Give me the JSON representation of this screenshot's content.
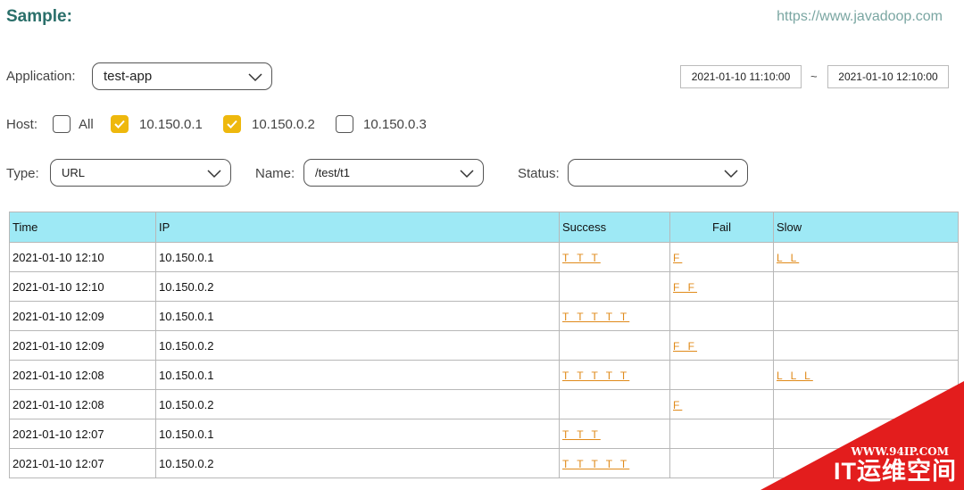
{
  "header": {
    "title": "Sample:",
    "site": "https://www.javadoop.com"
  },
  "filters": {
    "application": {
      "label": "Application:",
      "value": "test-app"
    },
    "date_range": {
      "start": "2021-01-10 11:10:00",
      "separator": "~",
      "end": "2021-01-10 12:10:00"
    },
    "host": {
      "label": "Host:",
      "options": [
        {
          "label": "All",
          "checked": false
        },
        {
          "label": "10.150.0.1",
          "checked": true
        },
        {
          "label": "10.150.0.2",
          "checked": true
        },
        {
          "label": "10.150.0.3",
          "checked": false
        }
      ]
    },
    "type": {
      "label": "Type:",
      "value": "URL"
    },
    "name": {
      "label": "Name:",
      "value": "/test/t1"
    },
    "status": {
      "label": "Status:",
      "value": ""
    }
  },
  "table": {
    "columns": [
      "Time",
      "IP",
      "Success",
      "Fail",
      "Slow"
    ],
    "rows": [
      {
        "time": "2021-01-10 12:10",
        "ip": "10.150.0.1",
        "success": "T T T",
        "fail": "F",
        "slow": "L L"
      },
      {
        "time": "2021-01-10 12:10",
        "ip": "10.150.0.2",
        "success": "",
        "fail": "F F",
        "slow": ""
      },
      {
        "time": "2021-01-10 12:09",
        "ip": "10.150.0.1",
        "success": "T T T T T",
        "fail": "",
        "slow": ""
      },
      {
        "time": "2021-01-10 12:09",
        "ip": "10.150.0.2",
        "success": "",
        "fail": "F F",
        "slow": ""
      },
      {
        "time": "2021-01-10 12:08",
        "ip": "10.150.0.1",
        "success": "T T T T T",
        "fail": "",
        "slow": "L L L"
      },
      {
        "time": "2021-01-10 12:08",
        "ip": "10.150.0.2",
        "success": "",
        "fail": "F",
        "slow": ""
      },
      {
        "time": "2021-01-10 12:07",
        "ip": "10.150.0.1",
        "success": "T T T",
        "fail": "",
        "slow": ""
      },
      {
        "time": "2021-01-10 12:07",
        "ip": "10.150.0.2",
        "success": "T T T T T",
        "fail": "",
        "slow": ""
      }
    ]
  },
  "watermark": {
    "url": "WWW.94IP.COM",
    "text": "IT运维空间"
  },
  "colors": {
    "title": "#2a6f6a",
    "header_bg": "#9ee9f5",
    "checkbox_on": "#eeb80d",
    "mark": "#e08a1a",
    "watermark": "#e31d1d"
  },
  "icons": {
    "select": "chevron-down-icon",
    "checkbox": "checkmark-icon"
  }
}
